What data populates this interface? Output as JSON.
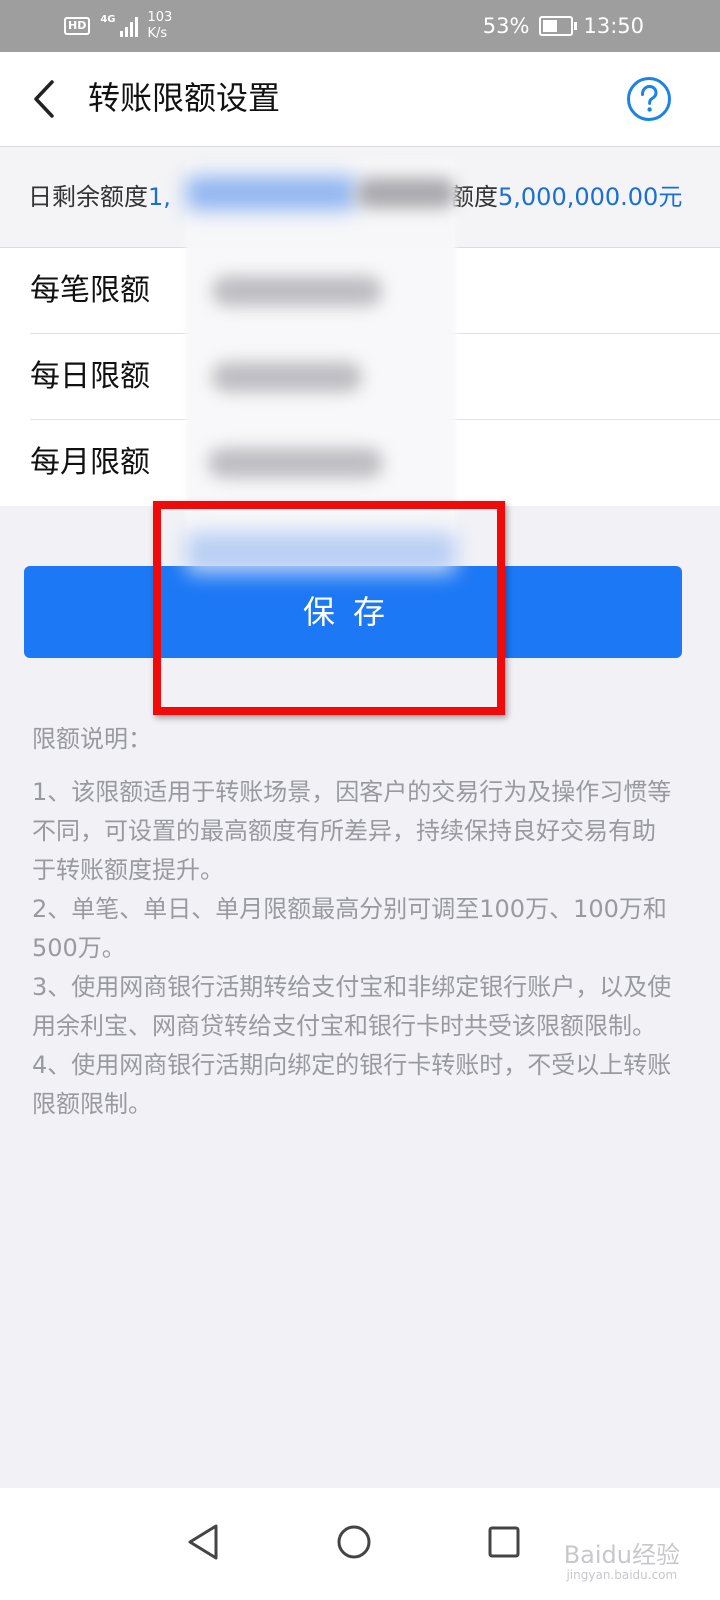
{
  "status_bar": {
    "hd": "HD",
    "network": "4G",
    "speed_value": "103",
    "speed_unit": "K/s",
    "battery": "53%",
    "time": "13:50"
  },
  "header": {
    "title": "转账限额设置"
  },
  "quota": {
    "left_label": "日剩余额度",
    "left_value_prefix": "1,",
    "right_label": "额度",
    "right_value": "5,000,000.00元"
  },
  "limits": [
    {
      "label": "每笔限额"
    },
    {
      "label": "每日限额"
    },
    {
      "label": "每月限额"
    }
  ],
  "save_label": "保存",
  "notes": {
    "title": "限额说明：",
    "items": [
      "1、该限额适用于转账场景，因客户的交易行为及操作习惯等不同，可设置的最高额度有所差异，持续保持良好交易有助于转账额度提升。",
      "2、单笔、单日、单月限额最高分别可调至100万、100万和500万。",
      "3、使用网商银行活期转给支付宝和非绑定银行账户，以及使用余利宝、网商贷转给支付宝和银行卡时共受该限额限制。",
      "4、使用网商银行活期向绑定的银行卡转账时，不受以上转账限额限制。"
    ]
  },
  "watermark": {
    "main": "Baidu经验",
    "sub": "jingyan.baidu.com"
  },
  "colors": {
    "accent": "#1c78f5",
    "highlight": "#f00a0a",
    "link_blue": "#1a6fd6"
  }
}
